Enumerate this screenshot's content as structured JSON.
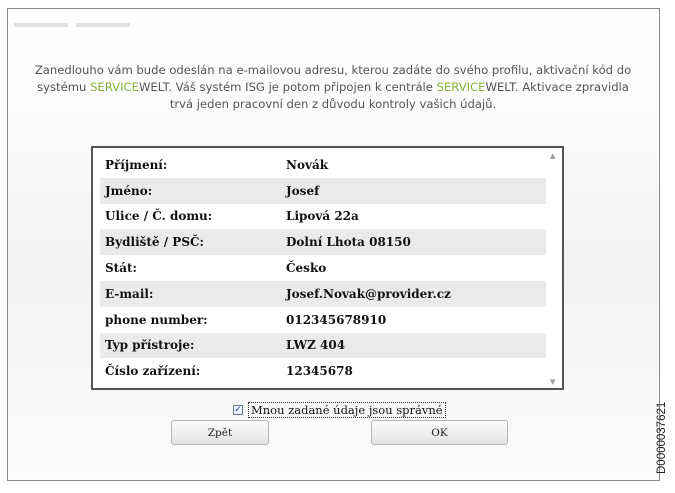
{
  "intro": {
    "part1": "Zanedlouho vám bude odeslán na e-mailovou adresu, kterou zadáte do svého profilu, aktivační kód do systému ",
    "brand_service_1": "SERVICE",
    "brand_welt_1": "WELT",
    "part2": ". Váš systém ISG je potom připojen k centrále ",
    "brand_service_2": "SERVICE",
    "brand_welt_2": "WELT",
    "part3": ". Aktivace zpravidla trvá jeden pracovní den z důvodu kontroly vašich údajů."
  },
  "rows": [
    {
      "label": "Příjmení:",
      "value": "Novák"
    },
    {
      "label": "Jméno:",
      "value": "Josef"
    },
    {
      "label": "Ulice / Č. domu:",
      "value": "Lipová  22a"
    },
    {
      "label": "Bydliště / PSČ:",
      "value": "Dolní Lhota  08150"
    },
    {
      "label": "Stát:",
      "value": "Česko"
    },
    {
      "label": "E-mail:",
      "value": "Josef.Novak@provider.cz"
    },
    {
      "label": "phone number:",
      "value": "012345678910"
    },
    {
      "label": "Typ přístroje:",
      "value": "LWZ 404"
    },
    {
      "label": "Číslo zařízení:",
      "value": "12345678"
    }
  ],
  "confirm": {
    "label": "Mnou zadané údaje jsou správné",
    "checked": true
  },
  "buttons": {
    "back": "Zpět",
    "ok": "OK"
  },
  "side_code": "D0000037621",
  "colors": {
    "accent": "#8ab23a",
    "row_alt": "#eaeaea"
  }
}
